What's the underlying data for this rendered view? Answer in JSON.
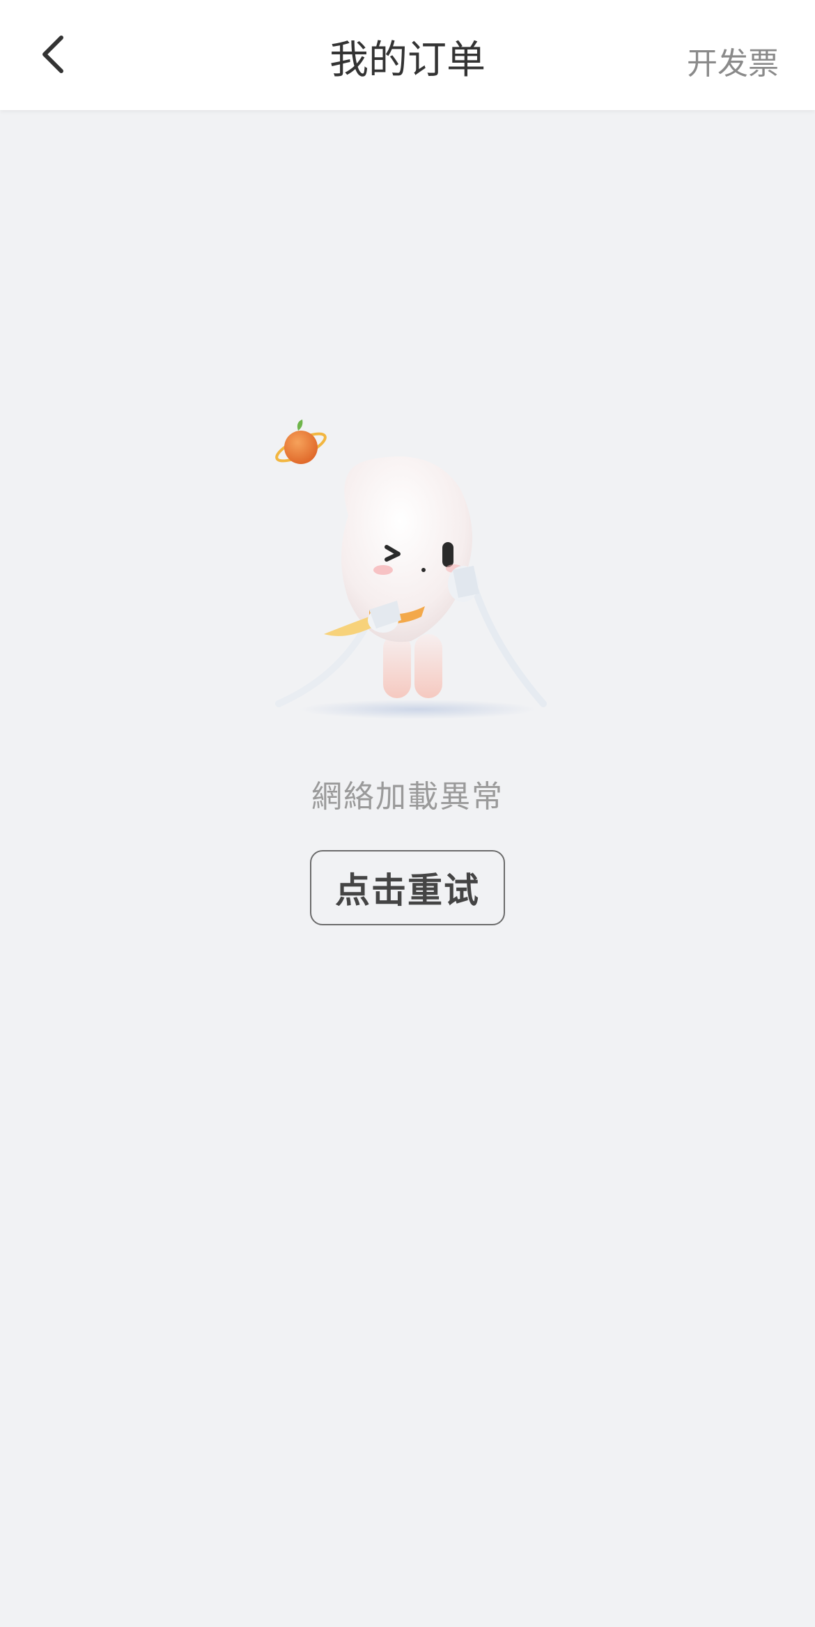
{
  "header": {
    "title": "我的订单",
    "invoice_label": "开发票",
    "back_icon": "chevron-left-icon"
  },
  "empty_state": {
    "message": "網絡加載異常",
    "retry_label": "点击重试",
    "illustration": "mascot-with-cable"
  },
  "colors": {
    "background": "#f1f2f4",
    "header_bg": "#ffffff",
    "title": "#333333",
    "secondary_text": "#8a8a8a",
    "accent_orange": "#f08a3c"
  }
}
